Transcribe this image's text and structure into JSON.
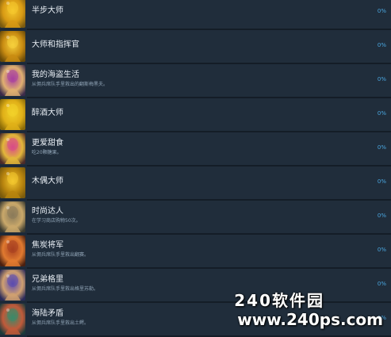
{
  "achievements": [
    {
      "title": "半步大师",
      "description": "",
      "percent": "0%",
      "icon": "gold-figure-icon",
      "colors": [
        "#7a5a10",
        "#f5c92e",
        "#d89a14"
      ]
    },
    {
      "title": "大师和指挥官",
      "description": "",
      "percent": "0%",
      "icon": "gold-bust-icon",
      "colors": [
        "#6a4a08",
        "#f6d03c",
        "#c98c12"
      ]
    },
    {
      "title": "我的海盗生活",
      "description": "从佣兵席队手里救出的翻斯梅黑夫。",
      "percent": "0%",
      "icon": "pirate-portrait-icon",
      "colors": [
        "#3a2a4a",
        "#a83fa0",
        "#e0b070"
      ]
    },
    {
      "title": "醉酒大师",
      "description": "",
      "percent": "0%",
      "icon": "gold-coins-icon",
      "colors": [
        "#8a6a08",
        "#f2d22a",
        "#e0b018"
      ]
    },
    {
      "title": "更爱甜食",
      "description": "吃20颗糖果。",
      "percent": "0%",
      "icon": "candy-pile-icon",
      "colors": [
        "#4a2a2a",
        "#d84a88",
        "#e2b63a"
      ]
    },
    {
      "title": "木偶大师",
      "description": "",
      "percent": "0%",
      "icon": "gold-puppet-icon",
      "colors": [
        "#7a5a0c",
        "#f4c830",
        "#b8840e"
      ]
    },
    {
      "title": "时尚达人",
      "description": "在学习商店购物50次。",
      "percent": "0%",
      "icon": "fashion-shop-icon",
      "colors": [
        "#3a3a30",
        "#8a7a5a",
        "#c9a86a"
      ]
    },
    {
      "title": "焦炭将军",
      "description": "从佣兵席队手里救出翻赛。",
      "percent": "0%",
      "icon": "armored-general-icon",
      "colors": [
        "#4a2010",
        "#a84020",
        "#e07a30"
      ]
    },
    {
      "title": "兄弟格里",
      "description": "从佣兵席队手里救出格里苏勒。",
      "percent": "0%",
      "icon": "wizard-portrait-icon",
      "colors": [
        "#2a2a5a",
        "#5a4ab0",
        "#d0a070"
      ]
    },
    {
      "title": "海陆矛盾",
      "description": "从佣兵席队手里救出土鳄。",
      "percent": "0%",
      "icon": "sea-creature-icon",
      "colors": [
        "#1a3a3a",
        "#3a8a6a",
        "#c05a3a"
      ]
    }
  ],
  "watermark": {
    "title": "240软件园",
    "url": "www.240ps.com"
  }
}
